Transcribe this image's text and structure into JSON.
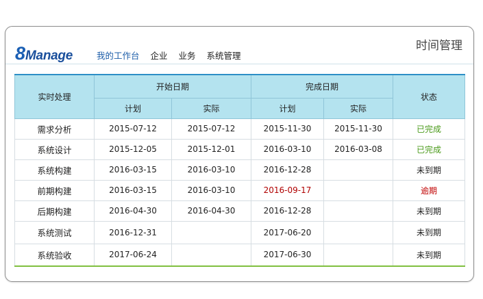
{
  "app": {
    "logo_digit": "8",
    "logo_word": "Manage",
    "page_title": "时间管理"
  },
  "nav": {
    "items": [
      "我的工作台",
      "企业",
      "业务",
      "系统管理"
    ],
    "active_index": 0
  },
  "colors": {
    "brand": "#1a4f9c",
    "nav_active": "#1b5ca8",
    "header_bg": "#b4e3ef",
    "status_done": "#4a9a1a",
    "status_overdue": "#c00000",
    "bottom_rule": "#7fbf3f"
  },
  "table": {
    "header": {
      "realtime": "实时处理",
      "start_group": "开始日期",
      "finish_group": "完成日期",
      "status": "状态",
      "plan": "计划",
      "actual": "实际"
    },
    "rows": [
      {
        "name": "需求分析",
        "start_plan": "2015-07-12",
        "start_actual": "2015-07-12",
        "finish_plan": "2015-11-30",
        "finish_actual": "2015-11-30",
        "status": "已完成",
        "status_type": "done"
      },
      {
        "name": "系统设计",
        "start_plan": "2015-12-05",
        "start_actual": "2015-12-01",
        "finish_plan": "2016-03-10",
        "finish_actual": "2016-03-08",
        "status": "已完成",
        "status_type": "done"
      },
      {
        "name": "系统构建",
        "start_plan": "2016-03-15",
        "start_actual": "2016-03-10",
        "finish_plan": "2016-12-28",
        "finish_actual": "",
        "status": "未到期",
        "status_type": "pending"
      },
      {
        "name": "前期构建",
        "start_plan": "2016-03-15",
        "start_actual": "2016-03-10",
        "finish_plan": "2016-09-17",
        "finish_actual": "",
        "status": "逾期",
        "status_type": "overdue"
      },
      {
        "name": "后期构建",
        "start_plan": "2016-04-30",
        "start_actual": "2016-04-30",
        "finish_plan": "2016-12-28",
        "finish_actual": "",
        "status": "未到期",
        "status_type": "pending"
      },
      {
        "name": "系统测试",
        "start_plan": "2016-12-31",
        "start_actual": "",
        "finish_plan": "2017-06-20",
        "finish_actual": "",
        "status": "未到期",
        "status_type": "pending"
      },
      {
        "name": "系统验收",
        "start_plan": "2017-06-24",
        "start_actual": "",
        "finish_plan": "2017-06-30",
        "finish_actual": "",
        "status": "未到期",
        "status_type": "pending"
      }
    ]
  }
}
